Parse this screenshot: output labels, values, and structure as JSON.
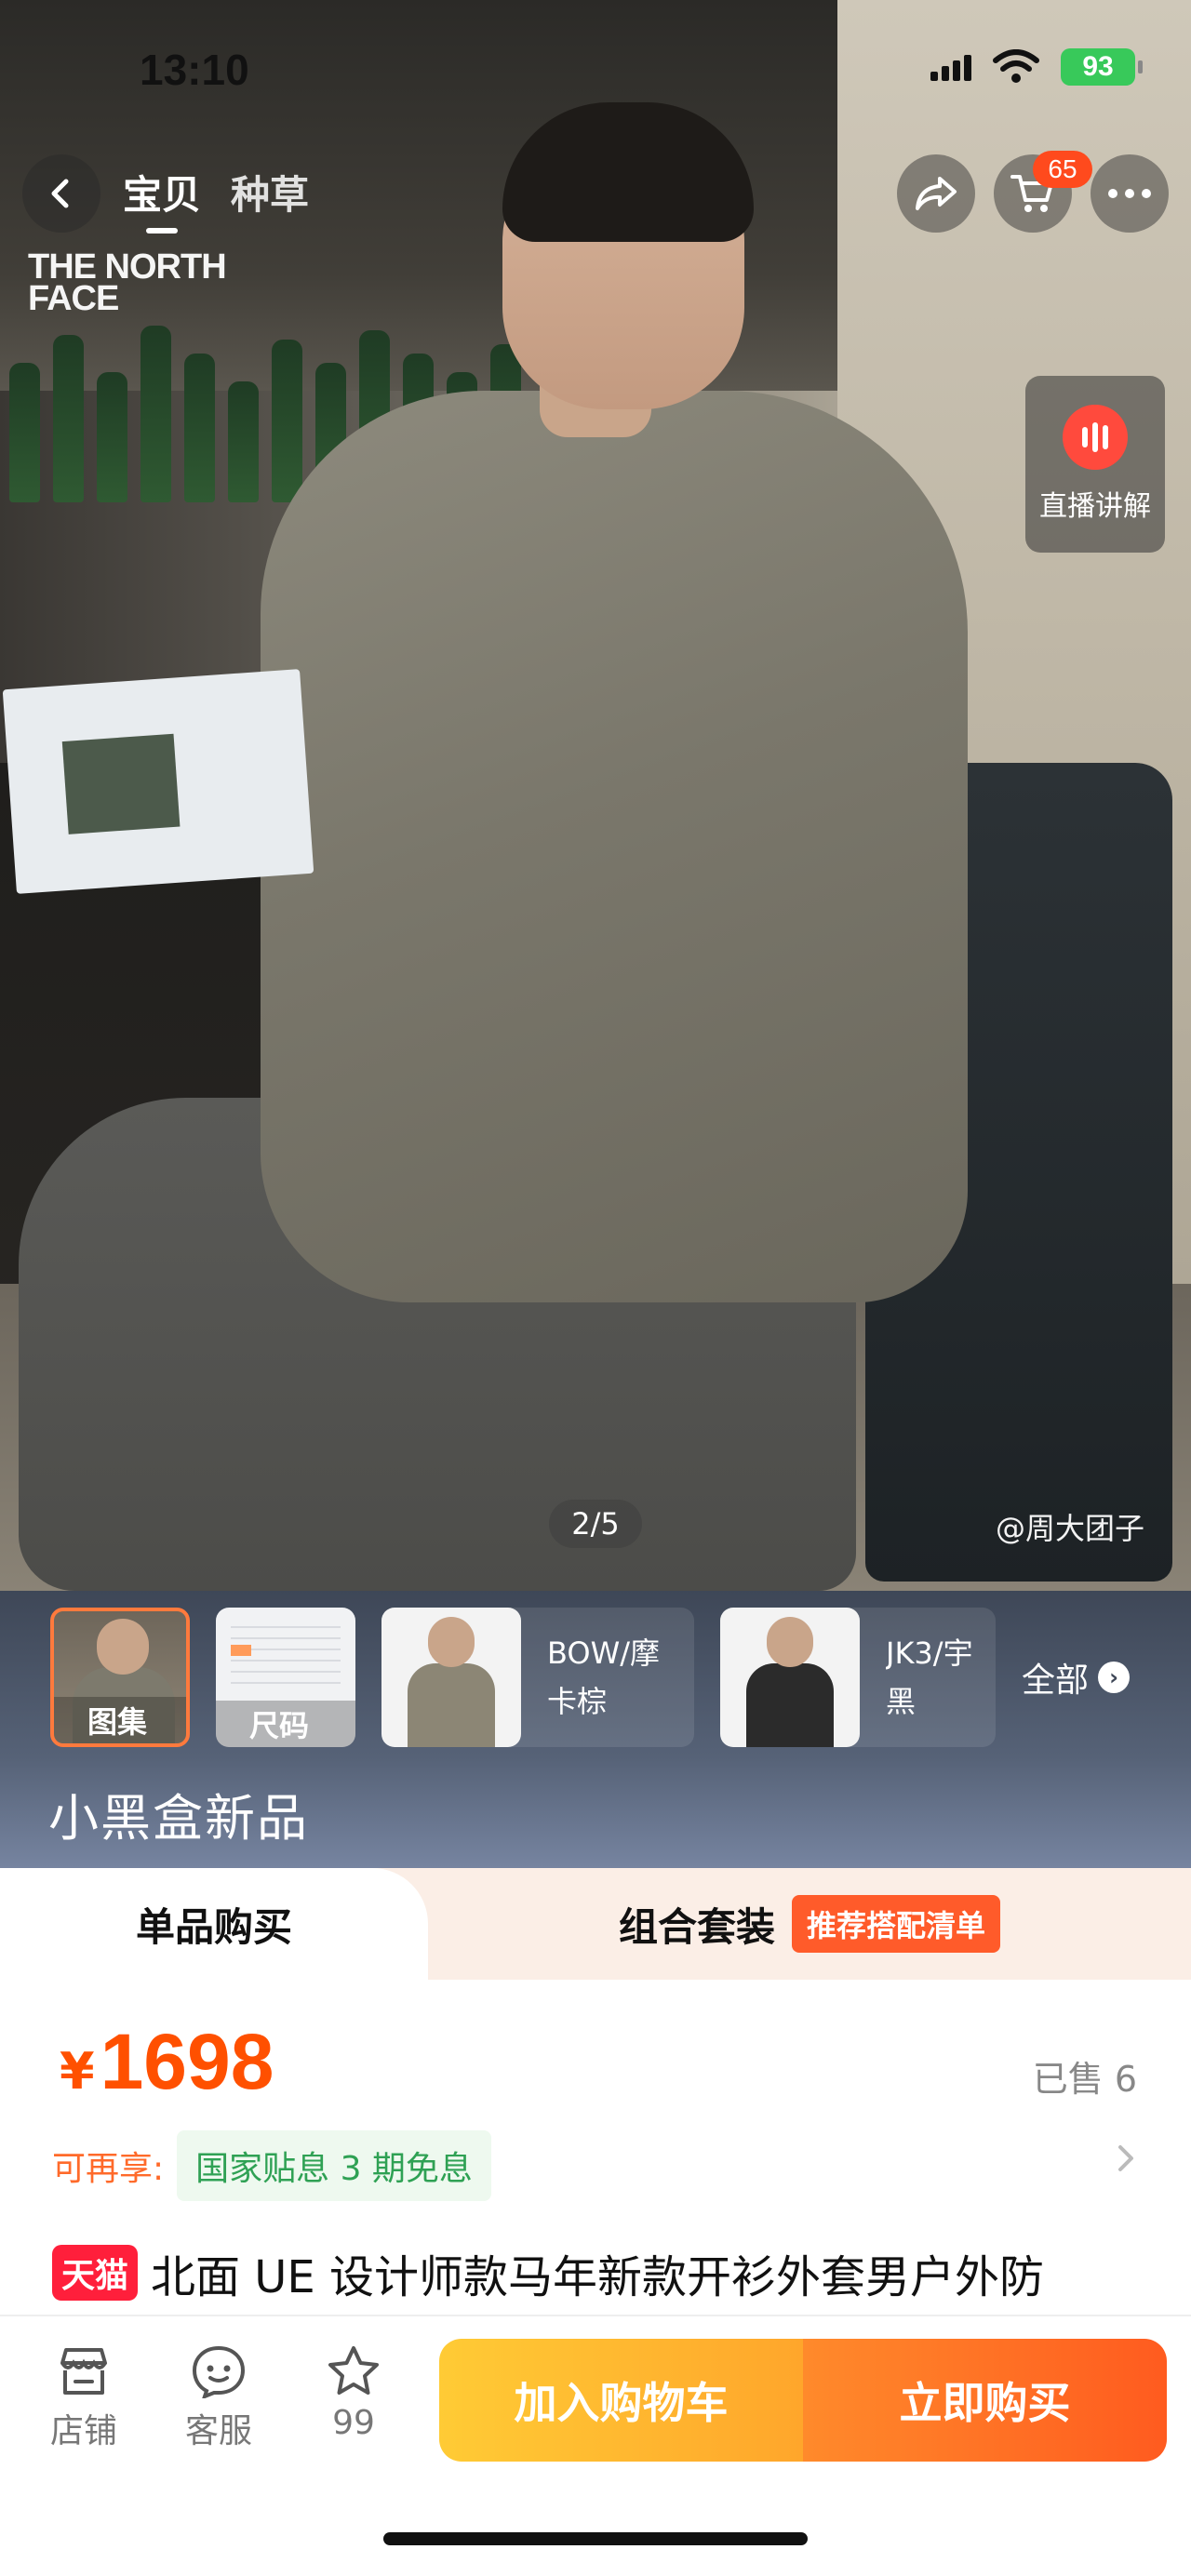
{
  "status_bar": {
    "time": "13:10",
    "battery": "93",
    "icons": [
      "signal-icon",
      "wifi-icon",
      "battery-icon"
    ]
  },
  "nav": {
    "tabs": [
      {
        "label": "宝贝",
        "active": true
      },
      {
        "label": "种草",
        "active": false
      }
    ],
    "cart_count": "65",
    "icons": [
      "back-arrow-icon",
      "share-icon",
      "cart-icon",
      "more-icon"
    ]
  },
  "hero": {
    "brand_logo": "THE NORTH FACE",
    "page_indicator": "2/5",
    "watermark": "@周大团子",
    "live_label": "直播讲解"
  },
  "thumbnails": {
    "gallery_label": "图集",
    "size_label": "尺码",
    "variants": [
      {
        "label": "BOW/摩卡棕",
        "color": "#8c8675"
      },
      {
        "label": "JK3/宇黑",
        "color": "#2b2b2b"
      }
    ],
    "all_label": "全部",
    "banner_title": "小黑盒新品"
  },
  "purchase_tabs": {
    "single": "单品购买",
    "combo": "组合套装",
    "combo_badge": "推荐搭配清单"
  },
  "price": {
    "currency": "¥",
    "value": "1698",
    "sold": "已售 6",
    "benefit_label": "可再享:",
    "benefit_chip": "国家贴息 3 期免息"
  },
  "product": {
    "tag": "天猫",
    "title": "北面 UE 设计师款马年新款开衫外套男户外防"
  },
  "bottom_bar": {
    "store_label": "店铺",
    "service_label": "客服",
    "fav_count": "99",
    "add_cart": "加入购物车",
    "buy_now": "立即购买"
  },
  "colors": {
    "accent": "#ff5000",
    "cart_button": "#ffb12f",
    "buy_button": "#ff6a1f",
    "tmall_red": "#ff1f3b",
    "benefit_green": "#2fa154"
  }
}
